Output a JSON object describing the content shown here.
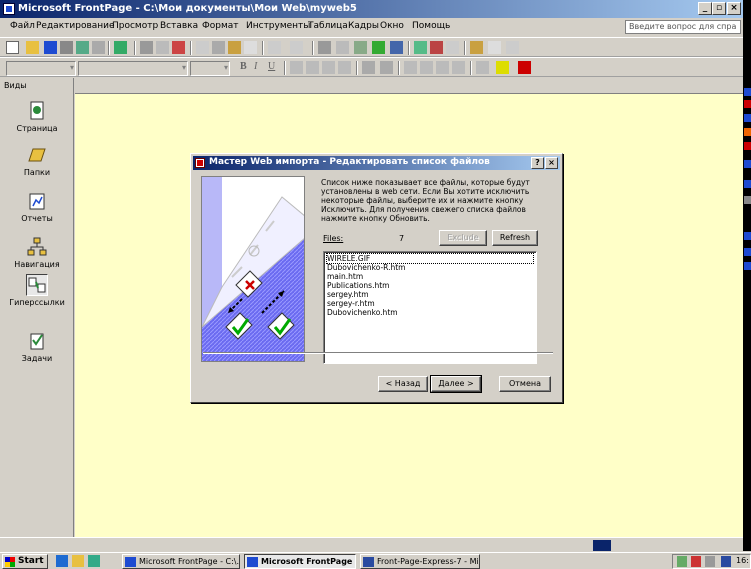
{
  "window": {
    "title": "Microsoft FrontPage - C:\\Мои документы\\Мои Web\\myweb5",
    "min": "_",
    "max": "▫",
    "close": "×"
  },
  "menu": {
    "items": [
      "Файл",
      "Редактирование",
      "Просмотр",
      "Вставка",
      "Формат",
      "Инструменты",
      "Таблица",
      "Кадры",
      "Окно",
      "Помощь"
    ],
    "help_placeholder": "Введите вопрос для спра"
  },
  "views": {
    "header": "Виды",
    "items": [
      {
        "label": "Страница",
        "icon": "page-icon"
      },
      {
        "label": "Папки",
        "icon": "folder-icon"
      },
      {
        "label": "Отчеты",
        "icon": "reports-icon"
      },
      {
        "label": "Навигация",
        "icon": "navigation-icon"
      },
      {
        "label": "Гиперссылки",
        "icon": "hyperlinks-icon"
      },
      {
        "label": "Задачи",
        "icon": "tasks-icon"
      }
    ],
    "selected": "Гиперссылки"
  },
  "format_toolbar": {
    "bold": "B",
    "italic": "I",
    "underline": "U"
  },
  "dialog": {
    "title": "Мастер Web импорта - Редактировать список файлов",
    "help": "?",
    "close": "×",
    "description": "Список ниже показывает все файлы, которые будут установлены в web сети. Если Вы хотите исключить некоторые файлы, выберите их и нажмите кнопку Исключить. Для получения свежего списка файлов нажмите кнопку Обновить.",
    "files_label": "Files:",
    "files_count": "7",
    "exclude_button": "Exclude",
    "refresh_button": "Refresh",
    "files": [
      "WIRELE.GIF",
      "Dubovichenko-R.htm",
      "main.htm",
      "Publications.htm",
      "sergey.htm",
      "sergey-r.htm",
      "Dubovichenko.htm"
    ],
    "back_button": "< Назад",
    "next_button": "Далее >",
    "cancel_button": "Отмена"
  },
  "taskbar": {
    "start": "Start",
    "tasks": [
      {
        "label": "Microsoft FrontPage - C:\\...",
        "active": false
      },
      {
        "label": "Microsoft FrontPage -...",
        "active": true
      },
      {
        "label": "Front-Page-Express-7 - Mic...",
        "active": false
      }
    ],
    "clock": "16:"
  },
  "colors": {
    "editor_bg": "#ffffc8",
    "titlebar_start": "#0a246a",
    "titlebar_end": "#a6caf0",
    "illustration_blue": "#6a6af0"
  }
}
